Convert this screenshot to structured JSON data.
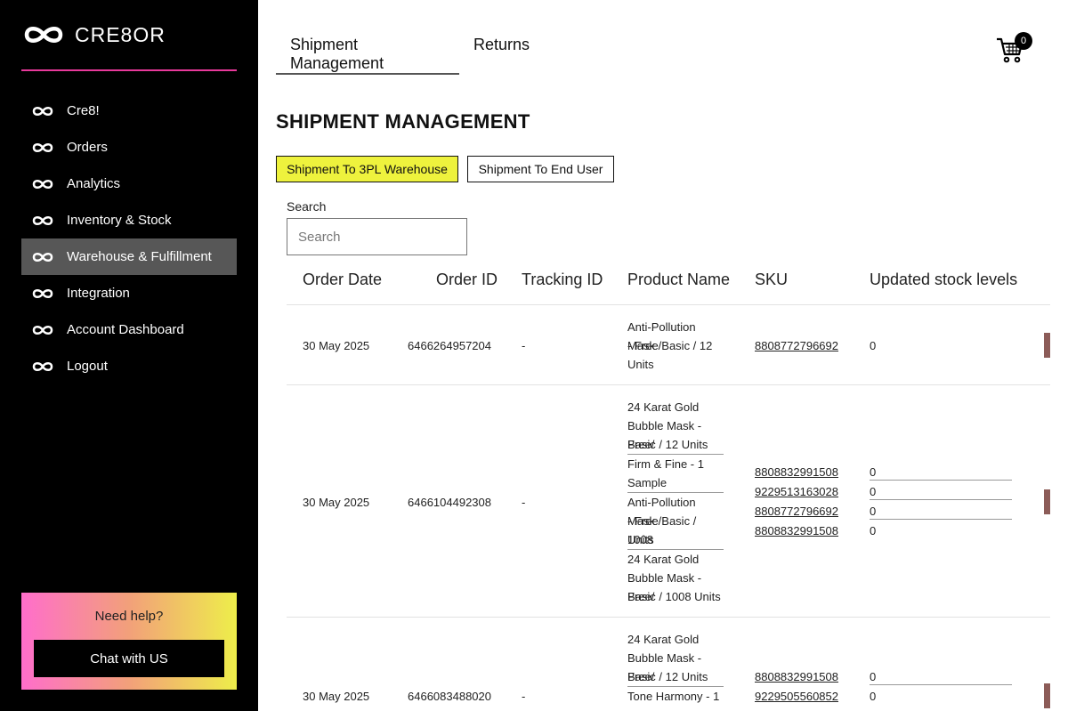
{
  "brand": {
    "name": "CRE8OR",
    "logo_icon": "infinity-icon"
  },
  "sidebar": {
    "items": [
      {
        "label": "Cre8!",
        "icon": "infinity-icon"
      },
      {
        "label": "Orders",
        "icon": "infinity-icon"
      },
      {
        "label": "Analytics",
        "icon": "infinity-icon"
      },
      {
        "label": "Inventory & Stock",
        "icon": "infinity-icon"
      },
      {
        "label": "Warehouse & Fulfillment",
        "icon": "infinity-icon",
        "active": true
      },
      {
        "label": "Integration",
        "icon": "infinity-icon"
      },
      {
        "label": "Account Dashboard",
        "icon": "infinity-icon"
      },
      {
        "label": "Logout",
        "icon": "infinity-icon"
      }
    ],
    "help": {
      "title": "Need help?",
      "button": "Chat with US"
    }
  },
  "tabs": [
    {
      "label": "Shipment Management",
      "active": true
    },
    {
      "label": "Returns",
      "active": false
    }
  ],
  "cart": {
    "icon": "cart-icon",
    "count": "0"
  },
  "page_title": "SHIPMENT MANAGEMENT",
  "mode_buttons": {
    "warehouse": "Shipment To 3PL Warehouse",
    "end_user": "Shipment To End User"
  },
  "search": {
    "label": "Search",
    "placeholder": "Search",
    "value": ""
  },
  "table": {
    "headers": [
      "Order Date",
      "Order ID",
      "Tracking ID",
      "Product Name",
      "SKU",
      "Updated stock levels"
    ],
    "rows": [
      {
        "date": "30 May 2025",
        "order_id": "6466264957204",
        "tracking": "-",
        "products": [
          [
            "Anti-Pollution Mask",
            "- Free/Basic / 12",
            "Units"
          ]
        ],
        "skus": [
          "8808772796692"
        ],
        "stock": [
          "0"
        ]
      },
      {
        "date": "30 May 2025",
        "order_id": "6466104492308",
        "tracking": "-",
        "products": [
          [
            "24 Karat Gold",
            "Bubble Mask - Free/",
            "Basic / 12 Units"
          ],
          [
            "Firm & Fine - 1",
            "Sample"
          ],
          [
            "Anti-Pollution Mask",
            "- Free/Basic / 1008",
            "Units"
          ],
          [
            "24 Karat Gold",
            "Bubble Mask - Free/",
            "Basic / 1008 Units"
          ]
        ],
        "skus": [
          "8808832991508",
          "9229513163028",
          "8808772796692",
          "8808832991508"
        ],
        "stock": [
          "0",
          "0",
          "0",
          "0"
        ]
      },
      {
        "date": "30 May 2025",
        "order_id": "6466083488020",
        "tracking": "-",
        "products": [
          [
            "24 Karat Gold",
            "Bubble Mask - Free/",
            "Basic / 12 Units"
          ],
          [
            "Tone Harmony - 1"
          ]
        ],
        "skus": [
          "8808832991508",
          "9229505560852"
        ],
        "stock": [
          "0",
          "0"
        ]
      }
    ]
  }
}
